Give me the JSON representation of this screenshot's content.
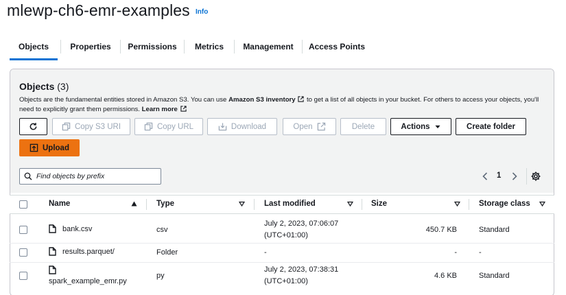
{
  "header": {
    "bucket_name": "mlewp-ch6-emr-examples",
    "info": "Info"
  },
  "tabs": [
    {
      "label": "Objects"
    },
    {
      "label": "Properties"
    },
    {
      "label": "Permissions"
    },
    {
      "label": "Metrics"
    },
    {
      "label": "Management"
    },
    {
      "label": "Access Points"
    }
  ],
  "objects": {
    "heading": "Objects",
    "count": "(3)",
    "desc_1": "Objects are the fundamental entities stored in Amazon S3. You can use ",
    "desc_link": "Amazon S3 inventory",
    "desc_2": " to get a list of all objects in your bucket. For others to access your objects, you'll need to explicitly grant them permissions. ",
    "learn_more": "Learn more"
  },
  "toolbar": {
    "copy_s3_uri": "Copy S3 URI",
    "copy_url": "Copy URL",
    "download": "Download",
    "open": "Open",
    "delete": "Delete",
    "actions": "Actions",
    "create_folder": "Create folder",
    "upload": "Upload"
  },
  "search": {
    "placeholder": "Find objects by prefix"
  },
  "pagination": {
    "page": "1"
  },
  "table": {
    "columns": [
      "Name",
      "Type",
      "Last modified",
      "Size",
      "Storage class"
    ],
    "rows": [
      {
        "name": "bank.csv",
        "type": "csv",
        "modified_1": "July 2, 2023, 07:06:07",
        "modified_2": "(UTC+01:00)",
        "size": "450.7 KB",
        "storage": "Standard"
      },
      {
        "name": "results.parquet/",
        "type": "Folder",
        "modified_1": "-",
        "modified_2": "",
        "size": "-",
        "storage": "-"
      },
      {
        "name": "spark_example_emr.py",
        "type": "py",
        "modified_1": "July 2, 2023, 07:38:31",
        "modified_2": "(UTC+01:00)",
        "size": "4.6 KB",
        "storage": "Standard"
      }
    ]
  },
  "colors": {
    "accent": "#0972d3",
    "primary_button": "#ec7211"
  },
  "icons": [
    "refresh-icon",
    "copy-icon",
    "download-icon",
    "external-link-icon",
    "caret-down-icon",
    "upload-icon",
    "search-icon",
    "chevron-left-icon",
    "chevron-right-icon",
    "gear-icon",
    "file-icon",
    "folder-icon"
  ]
}
